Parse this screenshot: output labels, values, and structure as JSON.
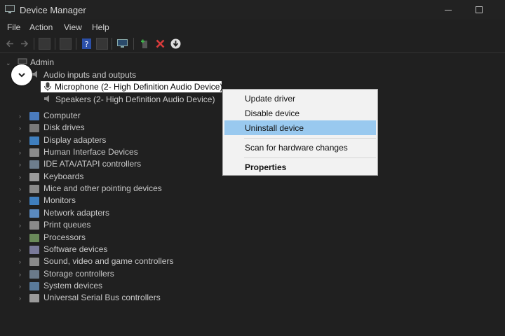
{
  "window": {
    "title": "Device Manager"
  },
  "menubar": {
    "items": [
      "File",
      "Action",
      "View",
      "Help"
    ]
  },
  "tree": {
    "root": "Admin",
    "expanded_category": "Audio inputs and outputs",
    "children": [
      "Microphone (2- High Definition Audio Device)",
      "Speakers (2- High Definition Audio Device)"
    ],
    "categories": [
      "Computer",
      "Disk drives",
      "Display adapters",
      "Human Interface Devices",
      "IDE ATA/ATAPI controllers",
      "Keyboards",
      "Mice and other pointing devices",
      "Monitors",
      "Network adapters",
      "Print queues",
      "Processors",
      "Software devices",
      "Sound, video and game controllers",
      "Storage controllers",
      "System devices",
      "Universal Serial Bus controllers"
    ]
  },
  "context_menu": {
    "update_driver": "Update driver",
    "disable_device": "Disable device",
    "uninstall_device": "Uninstall device",
    "scan_hardware": "Scan for hardware changes",
    "properties": "Properties"
  },
  "colors": {
    "background": "#202020",
    "selection": "#99c9ef",
    "remove_icon": "#d83b3b",
    "add_icon": "#3fb04a"
  },
  "icons": {
    "collapse": "chevron-down-icon",
    "remove": "red-x-icon",
    "download": "download-circle-icon"
  }
}
